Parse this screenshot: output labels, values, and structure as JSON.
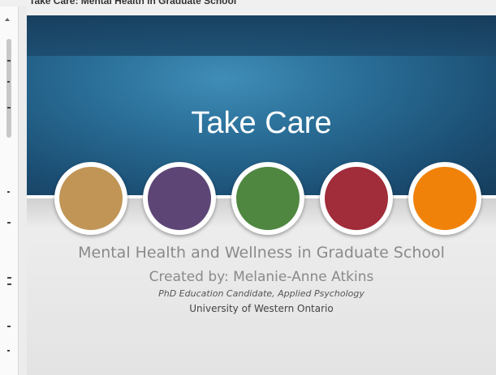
{
  "window": {
    "title": "Take Care: Mental Health in Graduate School"
  },
  "slide": {
    "title": "Take Care",
    "subtitle": "Mental Health and Wellness in Graduate School",
    "creator": "Created by: Melanie-Anne Atkins",
    "role": "PhD Education Candidate, Applied Psychology",
    "university": "University of Western Ontario",
    "circles": [
      {
        "color": "#c09556"
      },
      {
        "color": "#5d4676"
      },
      {
        "color": "#4f8740"
      },
      {
        "color": "#a12c3a"
      },
      {
        "color": "#f0820a"
      }
    ]
  },
  "colors": {
    "banner": "#2a6f98",
    "background": "#f0f0f0"
  }
}
